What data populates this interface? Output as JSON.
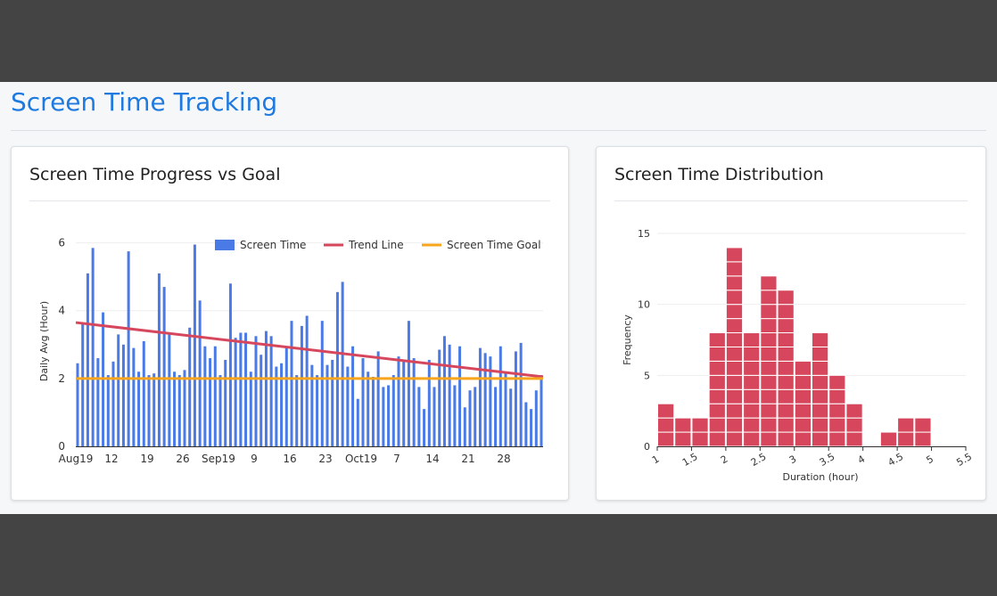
{
  "page": {
    "title": "Screen Time Tracking"
  },
  "cards": {
    "progress": {
      "title": "Screen Time Progress vs Goal"
    },
    "distribution": {
      "title": "Screen Time Distribution"
    }
  },
  "colors": {
    "title": "#1f7ae0",
    "bars": "#4a7ae6",
    "trend": "#d6475d",
    "goal": "#f7a51c",
    "histogram": "#d6475d"
  },
  "chart_data": [
    {
      "type": "bar",
      "ylabel": "Daily Avg (Hour)",
      "ylim": [
        0,
        6.2
      ],
      "yticks": [
        0,
        2,
        4,
        6
      ],
      "grid": true,
      "legend_position": "top-right",
      "x_start": "2019-08-19",
      "x_end": "2019-10-31",
      "xticks": [
        {
          "date": "2019-08-19",
          "label": "Aug19"
        },
        {
          "date": "2019-08-26",
          "label": "12"
        },
        {
          "date": "2019-09-02",
          "label": "19"
        },
        {
          "date": "2019-09-09",
          "label": "26"
        },
        {
          "date": "2019-09-16",
          "label": "Sep19"
        },
        {
          "date": "2019-09-23",
          "label": "9"
        },
        {
          "date": "2019-09-30",
          "label": "16"
        },
        {
          "date": "2019-10-07",
          "label": "23"
        },
        {
          "date": "2019-10-14",
          "label": "Oct19"
        },
        {
          "date": "2019-10-21",
          "label": "7"
        },
        {
          "date": "2019-10-28",
          "label": "14"
        },
        {
          "date": "2019-11-04",
          "label": "21"
        },
        {
          "date": "2019-11-11",
          "label": "28"
        }
      ],
      "series": [
        {
          "name": "Screen Time",
          "type": "bar",
          "values": [
            2.45,
            3.6,
            5.1,
            5.85,
            2.6,
            3.95,
            2.1,
            2.5,
            3.3,
            3.0,
            5.75,
            2.9,
            2.2,
            3.1,
            2.1,
            2.15,
            5.1,
            4.7,
            3.35,
            2.2,
            2.1,
            2.25,
            3.5,
            5.95,
            4.3,
            2.95,
            2.6,
            2.95,
            2.1,
            2.55,
            4.8,
            3.2,
            3.35,
            3.35,
            2.2,
            3.25,
            2.7,
            3.4,
            3.25,
            2.35,
            2.45,
            2.9,
            3.7,
            2.1,
            3.55,
            3.85,
            2.4,
            2.1,
            3.7,
            2.4,
            2.55,
            4.55,
            4.85,
            2.35,
            2.95,
            1.4,
            2.6,
            2.2,
            2.05,
            2.8,
            1.75,
            1.8,
            2.1,
            2.65,
            2.55,
            3.7,
            2.6,
            1.75,
            1.1,
            2.55,
            1.75,
            2.85,
            3.25,
            3.0,
            1.8,
            2.95,
            1.15,
            1.65,
            1.75,
            2.9,
            2.75,
            2.65,
            1.75,
            2.95,
            2.15,
            1.7,
            2.8,
            3.05,
            1.3,
            1.1,
            1.65,
            2.1
          ]
        },
        {
          "name": "Trend Line",
          "type": "line",
          "start": 3.65,
          "end": 2.05
        },
        {
          "name": "Screen Time Goal",
          "type": "line",
          "value": 2.0
        }
      ]
    },
    {
      "type": "bar",
      "xlabel": "Duration (hour)",
      "ylabel": "Frequency",
      "xlim": [
        1,
        5.5
      ],
      "ylim": [
        0,
        15
      ],
      "xticks": [
        1,
        1.5,
        2,
        2.5,
        3,
        3.5,
        4,
        4.5,
        5,
        5.5
      ],
      "yticks": [
        0,
        5,
        10,
        15
      ],
      "bin_width": 0.25,
      "grid": true,
      "series": [
        {
          "name": "Frequency",
          "bins": [
            1,
            1.25,
            1.5,
            1.75,
            2,
            2.25,
            2.5,
            2.75,
            3,
            3.25,
            3.5,
            3.75,
            4,
            4.25,
            4.5,
            4.75,
            5
          ],
          "values": [
            3,
            2,
            2,
            8,
            14,
            8,
            12,
            11,
            6,
            8,
            5,
            3,
            0,
            1,
            2,
            2,
            0
          ]
        }
      ]
    }
  ]
}
